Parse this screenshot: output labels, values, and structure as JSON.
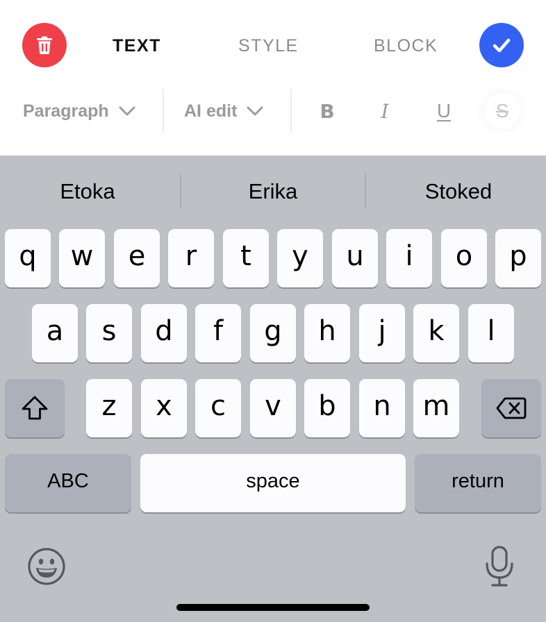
{
  "toolbar": {
    "delete_color": "#ef404a",
    "done_color": "#3362f3",
    "tabs": [
      {
        "label": "TEXT",
        "active": true
      },
      {
        "label": "STYLE",
        "active": false
      },
      {
        "label": "BLOCK",
        "active": false
      }
    ],
    "active_tab_color": "#111111",
    "inactive_tab_color": "#8a8a8a",
    "dropdowns": {
      "paragraph": "Paragraph",
      "ai_edit": "AI edit"
    },
    "format_buttons": {
      "bold": "B",
      "italic": "I",
      "underline": "U",
      "strikethrough": "S"
    },
    "format_color": "#9a9a9a",
    "strike_color": "#c6c6c6"
  },
  "keyboard": {
    "background": "#bdc0c4",
    "suggestions": [
      "Etoka",
      "Erika",
      "Stoked"
    ],
    "rows": [
      [
        "q",
        "w",
        "e",
        "r",
        "t",
        "y",
        "u",
        "i",
        "o",
        "p"
      ],
      [
        "a",
        "s",
        "d",
        "f",
        "g",
        "h",
        "j",
        "k",
        "l"
      ],
      [
        "z",
        "x",
        "c",
        "v",
        "b",
        "n",
        "m"
      ]
    ],
    "shift_icon": "shift-arrow-icon",
    "backspace_icon": "backspace-icon",
    "mode_switch_label": "ABC",
    "space_label": "space",
    "return_label": "return",
    "emoji_icon": "emoji-face-icon",
    "mic_icon": "microphone-icon"
  }
}
